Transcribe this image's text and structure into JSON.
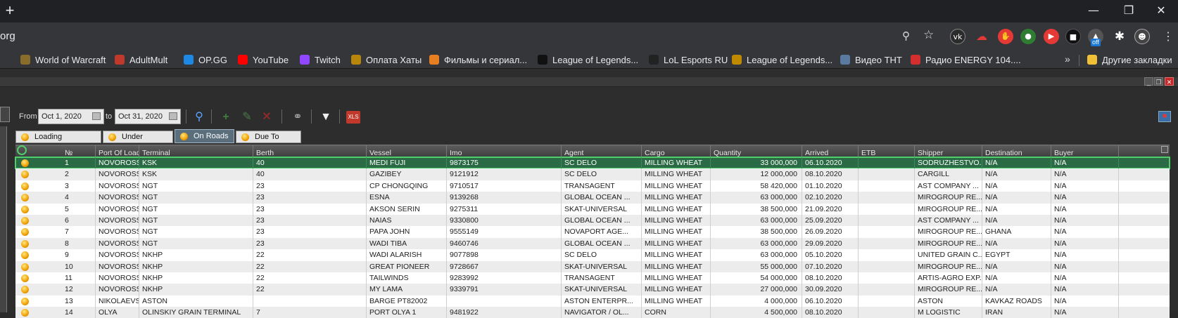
{
  "browser": {
    "url_fragment": "org",
    "bookmarks": [
      {
        "label": "World of Warcraft",
        "icon": "wow-icon",
        "color": "#8a6d2b"
      },
      {
        "label": "AdultMult",
        "icon": "adultmult-icon",
        "color": "#c0392b"
      },
      {
        "label": "OP.GG",
        "icon": "opgg-icon",
        "color": "#1e88e5"
      },
      {
        "label": "YouTube",
        "icon": "youtube-icon",
        "color": "#ff0000"
      },
      {
        "label": "Twitch",
        "icon": "twitch-icon",
        "color": "#9146ff"
      },
      {
        "label": "Оплата Хаты",
        "icon": "sun-icon",
        "color": "#b8860b"
      },
      {
        "label": "Фильмы и сериал...",
        "icon": "hd-icon",
        "color": "#e67e22"
      },
      {
        "label": "League of Legends...",
        "icon": "pb-icon",
        "color": "#111111"
      },
      {
        "label": "LoL Esports RU",
        "icon": "lol-icon",
        "color": "#222222"
      },
      {
        "label": "League of Legends...",
        "icon": "lol-crest-icon",
        "color": "#c08a00"
      },
      {
        "label": "Видео ТНТ",
        "icon": "tnt-icon",
        "color": "#5a7aa0"
      },
      {
        "label": "Радио ENERGY 104....",
        "icon": "radio-icon",
        "color": "#d32f2f"
      }
    ],
    "other_bookmarks": "Другие закладки",
    "more_chevron": "»",
    "ext_badge": "off"
  },
  "toolbar": {
    "from_label": "From",
    "from_date": "Oct 1, 2020",
    "to_label": "to",
    "to_date": "Oct 31, 2020"
  },
  "tabs": [
    {
      "label": "Loading Completed",
      "active": false
    },
    {
      "label": "Under Loading",
      "active": false
    },
    {
      "label": "On Roads",
      "active": true
    },
    {
      "label": "Due To Arrival",
      "active": false
    }
  ],
  "columns": [
    "№",
    "Port Of Loading",
    "Terminal",
    "Berth",
    "Vessel",
    "Imo",
    "Agent",
    "Cargo",
    "Quantity",
    "Arrived",
    "ETB",
    "Shipper",
    "Destination",
    "Buyer"
  ],
  "rows": [
    [
      "1",
      "NOVOROSSIYSK",
      "KSK",
      "40",
      "MEDI FUJI",
      "9873175",
      "SC DELO",
      "MILLING WHEAT",
      "33 000,000",
      "06.10.2020",
      "",
      "SODRUZHESTVO...",
      "N/A",
      "N/A"
    ],
    [
      "2",
      "NOVOROSSIYSK",
      "KSK",
      "40",
      "GAZIBEY",
      "9121912",
      "SC DELO",
      "MILLING WHEAT",
      "12 000,000",
      "08.10.2020",
      "",
      "CARGILL",
      "N/A",
      "N/A"
    ],
    [
      "3",
      "NOVOROSSIYSK",
      "NGT",
      "23",
      "CP CHONGQING",
      "9710517",
      "TRANSAGENT",
      "MILLING WHEAT",
      "58 420,000",
      "01.10.2020",
      "",
      "AST COMPANY ...",
      "N/A",
      "N/A"
    ],
    [
      "4",
      "NOVOROSSIYSK",
      "NGT",
      "23",
      "ESNA",
      "9139268",
      "GLOBAL OCEAN ...",
      "MILLING WHEAT",
      "63 000,000",
      "02.10.2020",
      "",
      "MIROGROUP RE...",
      "N/A",
      "N/A"
    ],
    [
      "5",
      "NOVOROSSIYSK",
      "NGT",
      "23",
      "AKSON SERIN",
      "9275311",
      "SKAT-UNIVERSAL",
      "MILLING WHEAT",
      "38 500,000",
      "21.09.2020",
      "",
      "MIROGROUP RE...",
      "N/A",
      "N/A"
    ],
    [
      "6",
      "NOVOROSSIYSK",
      "NGT",
      "23",
      "NAIAS",
      "9330800",
      "GLOBAL OCEAN ...",
      "MILLING WHEAT",
      "63 000,000",
      "25.09.2020",
      "",
      "AST COMPANY ...",
      "N/A",
      "N/A"
    ],
    [
      "7",
      "NOVOROSSIYSK",
      "NGT",
      "23",
      "PAPA JOHN",
      "9555149",
      "NOVAPORT AGE...",
      "MILLING WHEAT",
      "38 500,000",
      "26.09.2020",
      "",
      "MIROGROUP RE...",
      "GHANA",
      "N/A"
    ],
    [
      "8",
      "NOVOROSSIYSK",
      "NGT",
      "23",
      "WADI TIBA",
      "9460746",
      "GLOBAL OCEAN ...",
      "MILLING WHEAT",
      "63 000,000",
      "29.09.2020",
      "",
      "MIROGROUP RE...",
      "N/A",
      "N/A"
    ],
    [
      "9",
      "NOVOROSSIYSK",
      "NKHP",
      "22",
      "WADI ALARISH",
      "9077898",
      "SC DELO",
      "MILLING WHEAT",
      "63 000,000",
      "05.10.2020",
      "",
      "UNITED GRAIN C...",
      "EGYPT",
      "N/A"
    ],
    [
      "10",
      "NOVOROSSIYSK",
      "NKHP",
      "22",
      "GREAT PIONEER",
      "9728667",
      "SKAT-UNIVERSAL",
      "MILLING WHEAT",
      "55 000,000",
      "07.10.2020",
      "",
      "MIROGROUP RE...",
      "N/A",
      "N/A"
    ],
    [
      "11",
      "NOVOROSSIYSK",
      "NKHP",
      "22",
      "TAILWINDS",
      "9283992",
      "TRANSAGENT",
      "MILLING WHEAT",
      "54 000,000",
      "08.10.2020",
      "",
      "ARTIS-AGRO EXP...",
      "N/A",
      "N/A"
    ],
    [
      "12",
      "NOVOROSSIYSK",
      "NKHP",
      "22",
      "MY LAMA",
      "9339791",
      "SKAT-UNIVERSAL",
      "MILLING WHEAT",
      "27 000,000",
      "30.09.2020",
      "",
      "MIROGROUP RE...",
      "N/A",
      "N/A"
    ],
    [
      "13",
      "NIKOLAEVSKAYA",
      "ASTON",
      "",
      "BARGE PT82002",
      "",
      "ASTON ENTERPR...",
      "MILLING WHEAT",
      "4 000,000",
      "06.10.2020",
      "",
      "ASTON",
      "KAVKAZ ROADS",
      "N/A"
    ],
    [
      "14",
      "OLYA",
      "OLINSKIY GRAIN TERMINAL",
      "7",
      "PORT OLYA 1",
      "9481922",
      "NAVIGATOR / OL...",
      "CORN",
      "4 500,000",
      "08.10.2020",
      "",
      "M LOGISTIC",
      "IRAN",
      "N/A"
    ]
  ]
}
